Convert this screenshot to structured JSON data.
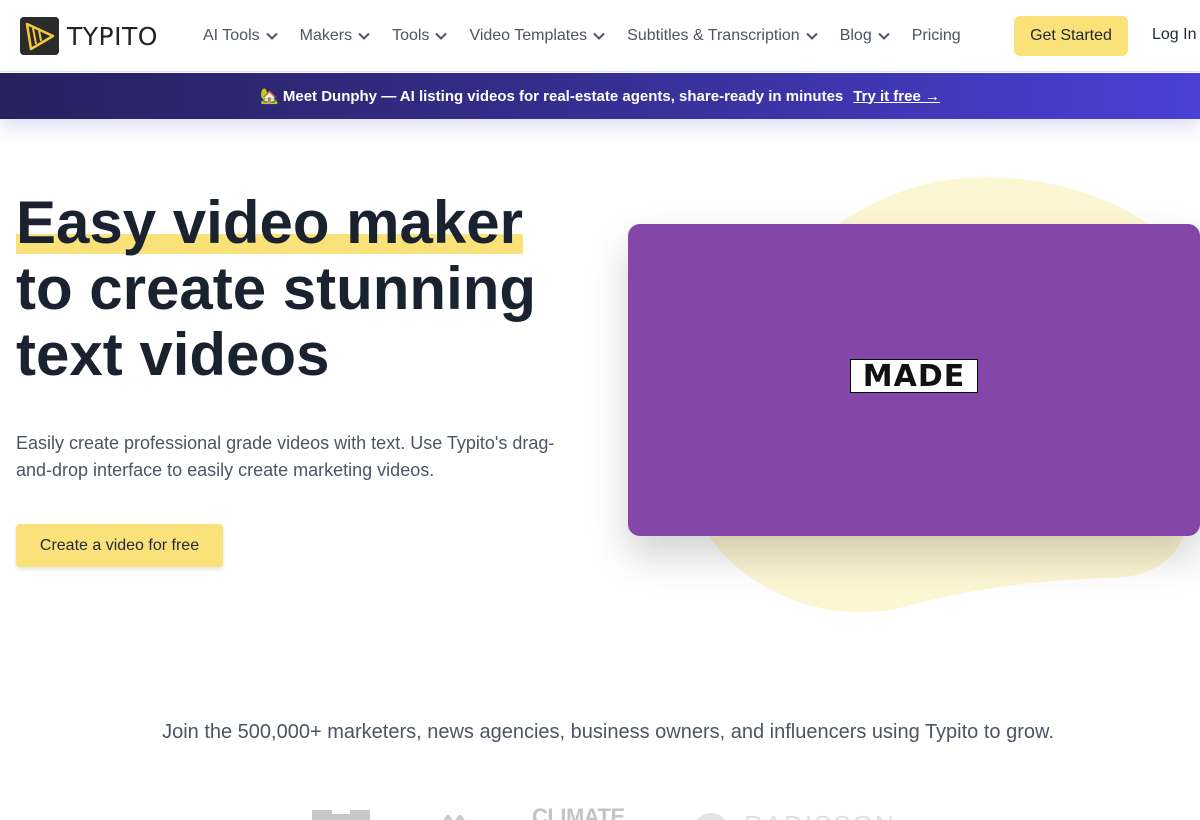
{
  "brand": {
    "name": "TYPITO"
  },
  "nav": {
    "items": [
      {
        "label": "AI Tools",
        "dropdown": true
      },
      {
        "label": "Makers",
        "dropdown": true
      },
      {
        "label": "Tools",
        "dropdown": true
      },
      {
        "label": "Video Templates",
        "dropdown": true
      },
      {
        "label": "Subtitles & Transcription",
        "dropdown": true
      },
      {
        "label": "Blog",
        "dropdown": true
      },
      {
        "label": "Pricing",
        "dropdown": false
      }
    ],
    "get_started": "Get Started",
    "login": "Log In"
  },
  "banner": {
    "text": "🏡 Meet Dunphy — AI listing videos for real-estate agents, share-ready in minutes",
    "link": "Try it free →"
  },
  "hero": {
    "title_highlight": "Easy video maker",
    "title_rest": "to create stunning text videos",
    "subtitle": "Easily create professional grade videos with text. Use Typito's drag-and-drop interface to easily create marketing videos.",
    "cta": "Create a video for free",
    "video_caption": "MADE"
  },
  "proof": {
    "text": "Join the 500,000+ marketers, news agencies, business owners, and influencers using Typito to grow.",
    "logos": [
      "CLIMATE",
      "RADISSON"
    ]
  },
  "colors": {
    "accent_yellow": "#fbe17a",
    "video_purple": "#8446a8",
    "banner_start": "#27215e",
    "banner_end": "#4a40d6",
    "blob": "#fdf6d3"
  }
}
